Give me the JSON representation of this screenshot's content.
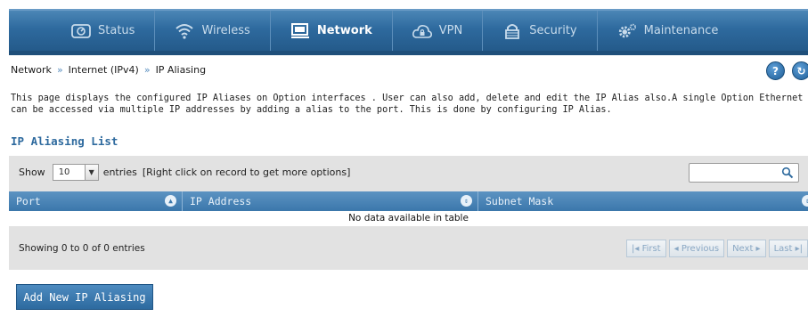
{
  "nav": {
    "items": [
      {
        "label": "Status",
        "icon": "status-icon",
        "active": false
      },
      {
        "label": "Wireless",
        "icon": "wifi-icon",
        "active": false
      },
      {
        "label": "Network",
        "icon": "monitor-icon",
        "active": true
      },
      {
        "label": "VPN",
        "icon": "vpn-icon",
        "active": false
      },
      {
        "label": "Security",
        "icon": "lock-icon",
        "active": false
      },
      {
        "label": "Maintenance",
        "icon": "gear-icon",
        "active": false
      }
    ]
  },
  "breadcrumb": {
    "items": [
      "Network",
      "Internet (IPv4)",
      "IP Aliasing"
    ],
    "separator": "»"
  },
  "help": {
    "help_label": "?",
    "refresh_label": "↻"
  },
  "description": {
    "line1": "This page displays the configured IP Aliases on Option interfaces . User can also add, delete and edit the IP Alias also.A single Option Ethernet port",
    "line2": "can be accessed via multiple IP addresses by adding a alias to the port. This is done by configuring IP Alias."
  },
  "section": {
    "title": "IP Aliasing List"
  },
  "table": {
    "show_label": "Show",
    "page_size": "10",
    "entries_label": "entries",
    "hint": "[Right click on record to get more options]",
    "search_placeholder": "",
    "columns": [
      "Port",
      "IP Address",
      "Subnet Mask"
    ],
    "empty_message": "No data available in table",
    "info": "Showing 0 to 0 of 0 entries",
    "pager": {
      "first": "First",
      "previous": "Previous",
      "next": "Next",
      "last": "Last"
    }
  },
  "add_button": {
    "label": "Add New IP Aliasing"
  },
  "colors": {
    "nav_bg": "#2e6a9e",
    "accent": "#2e6a9e",
    "panel": "#e2e2e2"
  }
}
